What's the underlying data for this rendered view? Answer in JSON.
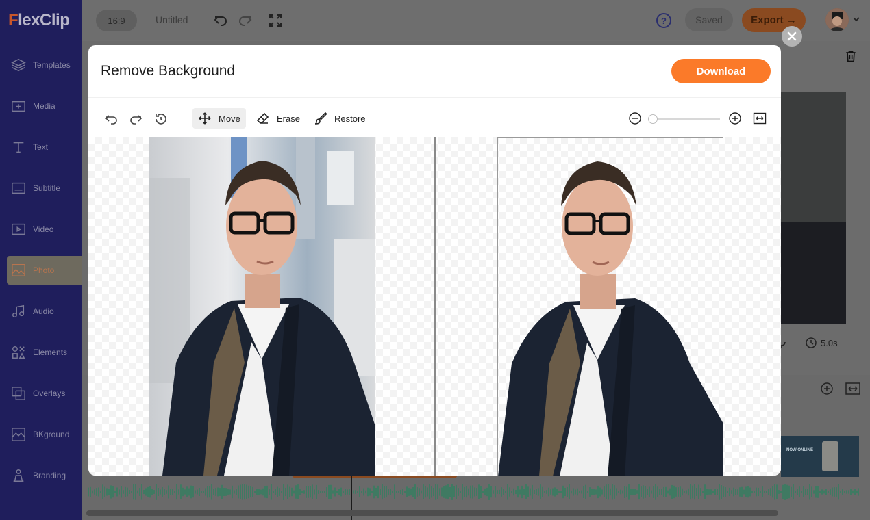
{
  "app": {
    "logo_text": "FlexClip",
    "brand_color": "#fb7a29"
  },
  "sidebar": {
    "items": [
      {
        "label": "Templates",
        "icon": "layers-icon"
      },
      {
        "label": "Media",
        "icon": "media-folder-icon"
      },
      {
        "label": "Text",
        "icon": "text-icon"
      },
      {
        "label": "Subtitle",
        "icon": "subtitle-icon"
      },
      {
        "label": "Video",
        "icon": "video-icon"
      },
      {
        "label": "Photo",
        "icon": "photo-icon",
        "active": true
      },
      {
        "label": "Audio",
        "icon": "music-note-icon"
      },
      {
        "label": "Elements",
        "icon": "elements-icon"
      },
      {
        "label": "Overlays",
        "icon": "overlays-icon"
      },
      {
        "label": "BKground",
        "icon": "background-icon"
      },
      {
        "label": "Branding",
        "icon": "branding-icon"
      }
    ]
  },
  "topbar": {
    "aspect_ratio": "16:9",
    "project_title": "Untitled",
    "help_label": "?",
    "saved_label": "Saved",
    "export_label": "Export →"
  },
  "editor": {
    "duration": "5.0s"
  },
  "thumbnail": {
    "text": "NOW ONLINE"
  },
  "modal": {
    "title": "Remove Background",
    "download_label": "Download",
    "tools": {
      "move": "Move",
      "erase": "Erase",
      "restore": "Restore"
    },
    "active_tool": "Move",
    "zoom_level": 0
  }
}
